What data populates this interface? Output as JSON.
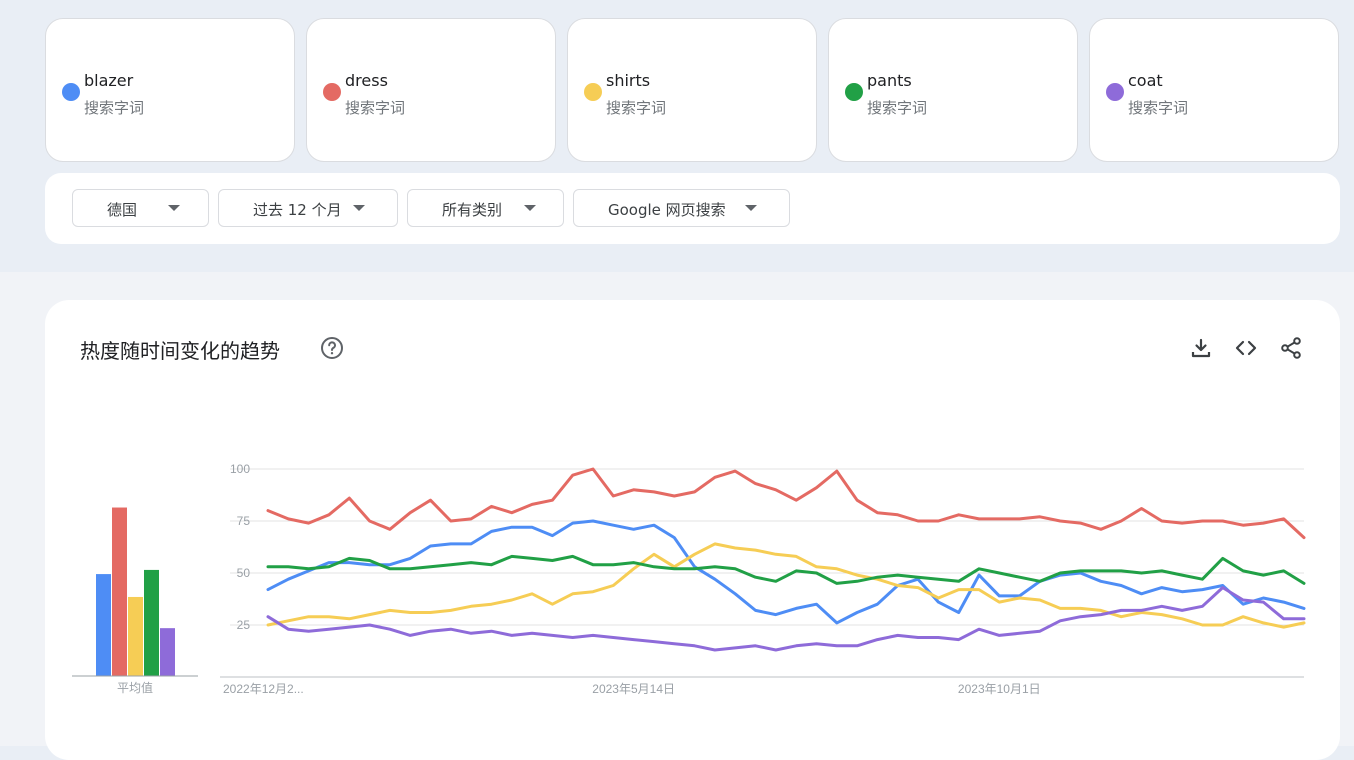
{
  "search_terms": [
    {
      "name": "blazer",
      "subtitle": "搜索字词",
      "color": "#4e8df5"
    },
    {
      "name": "dress",
      "subtitle": "搜索字词",
      "color": "#e46a63"
    },
    {
      "name": "shirts",
      "subtitle": "搜索字词",
      "color": "#f6cd55"
    },
    {
      "name": "pants",
      "subtitle": "搜索字词",
      "color": "#21a046"
    },
    {
      "name": "coat",
      "subtitle": "搜索字词",
      "color": "#8e6bd9"
    }
  ],
  "filters": {
    "region": "德国",
    "time_range": "过去 12 个月",
    "category": "所有类别",
    "search_type": "Google 网页搜索"
  },
  "chart_card": {
    "title": "热度随时间变化的趋势",
    "help_icon": "help-circle-icon",
    "download_icon": "download-icon",
    "embed_icon": "code-icon",
    "share_icon": "share-icon"
  },
  "chart_data": {
    "type": "line",
    "y_ticks": [
      25,
      50,
      75,
      100
    ],
    "ylim": [
      0,
      100
    ],
    "x_ticks": [
      "2022年12月2...",
      "2023年5月14日",
      "2023年10月1日"
    ],
    "x_tick_positions": [
      0,
      18,
      36
    ],
    "n_points": 52,
    "series": [
      {
        "name": "blazer",
        "color": "#4e8df5",
        "values": [
          42,
          47,
          51,
          55,
          55,
          54,
          54,
          57,
          63,
          64,
          64,
          70,
          72,
          72,
          68,
          74,
          75,
          73,
          71,
          73,
          67,
          53,
          47,
          40,
          32,
          30,
          33,
          35,
          26,
          31,
          35,
          44,
          47,
          36,
          31,
          49,
          39,
          39,
          46,
          49,
          50,
          46,
          44,
          40,
          43,
          41,
          42,
          44,
          35,
          38,
          36,
          33
        ]
      },
      {
        "name": "dress",
        "color": "#e46a63",
        "values": [
          80,
          76,
          74,
          78,
          86,
          75,
          71,
          79,
          85,
          75,
          76,
          82,
          79,
          83,
          85,
          97,
          100,
          87,
          90,
          89,
          87,
          89,
          96,
          99,
          93,
          90,
          85,
          91,
          99,
          85,
          79,
          78,
          75,
          75,
          78,
          76,
          76,
          76,
          77,
          75,
          74,
          71,
          75,
          81,
          75,
          74,
          75,
          75,
          73,
          74,
          76,
          67
        ]
      },
      {
        "name": "shirts",
        "color": "#f6cd55",
        "values": [
          25,
          27,
          29,
          29,
          28,
          30,
          32,
          31,
          31,
          32,
          34,
          35,
          37,
          40,
          35,
          40,
          41,
          44,
          52,
          59,
          53,
          59,
          64,
          62,
          61,
          59,
          58,
          53,
          52,
          49,
          47,
          44,
          43,
          38,
          42,
          42,
          36,
          38,
          37,
          33,
          33,
          32,
          29,
          31,
          30,
          28,
          25,
          25,
          29,
          26,
          24,
          26
        ]
      },
      {
        "name": "pants",
        "color": "#21a046",
        "values": [
          53,
          53,
          52,
          53,
          57,
          56,
          52,
          52,
          53,
          54,
          55,
          54,
          58,
          57,
          56,
          58,
          54,
          54,
          55,
          53,
          52,
          52,
          53,
          52,
          48,
          46,
          51,
          50,
          45,
          46,
          48,
          49,
          48,
          47,
          46,
          52,
          50,
          48,
          46,
          50,
          51,
          51,
          51,
          50,
          51,
          49,
          47,
          57,
          51,
          49,
          51,
          45
        ]
      },
      {
        "name": "coat",
        "color": "#8e6bd9",
        "values": [
          29,
          23,
          22,
          23,
          24,
          25,
          23,
          20,
          22,
          23,
          21,
          22,
          20,
          21,
          20,
          19,
          20,
          19,
          18,
          17,
          16,
          15,
          13,
          14,
          15,
          13,
          15,
          16,
          15,
          15,
          18,
          20,
          19,
          19,
          18,
          23,
          20,
          21,
          22,
          27,
          29,
          30,
          32,
          32,
          34,
          32,
          34,
          43,
          37,
          36,
          28,
          28
        ]
      }
    ],
    "average": {
      "label": "平均值",
      "values": [
        49,
        81,
        38,
        51,
        23
      ]
    },
    "grid": true,
    "legend": "top"
  }
}
